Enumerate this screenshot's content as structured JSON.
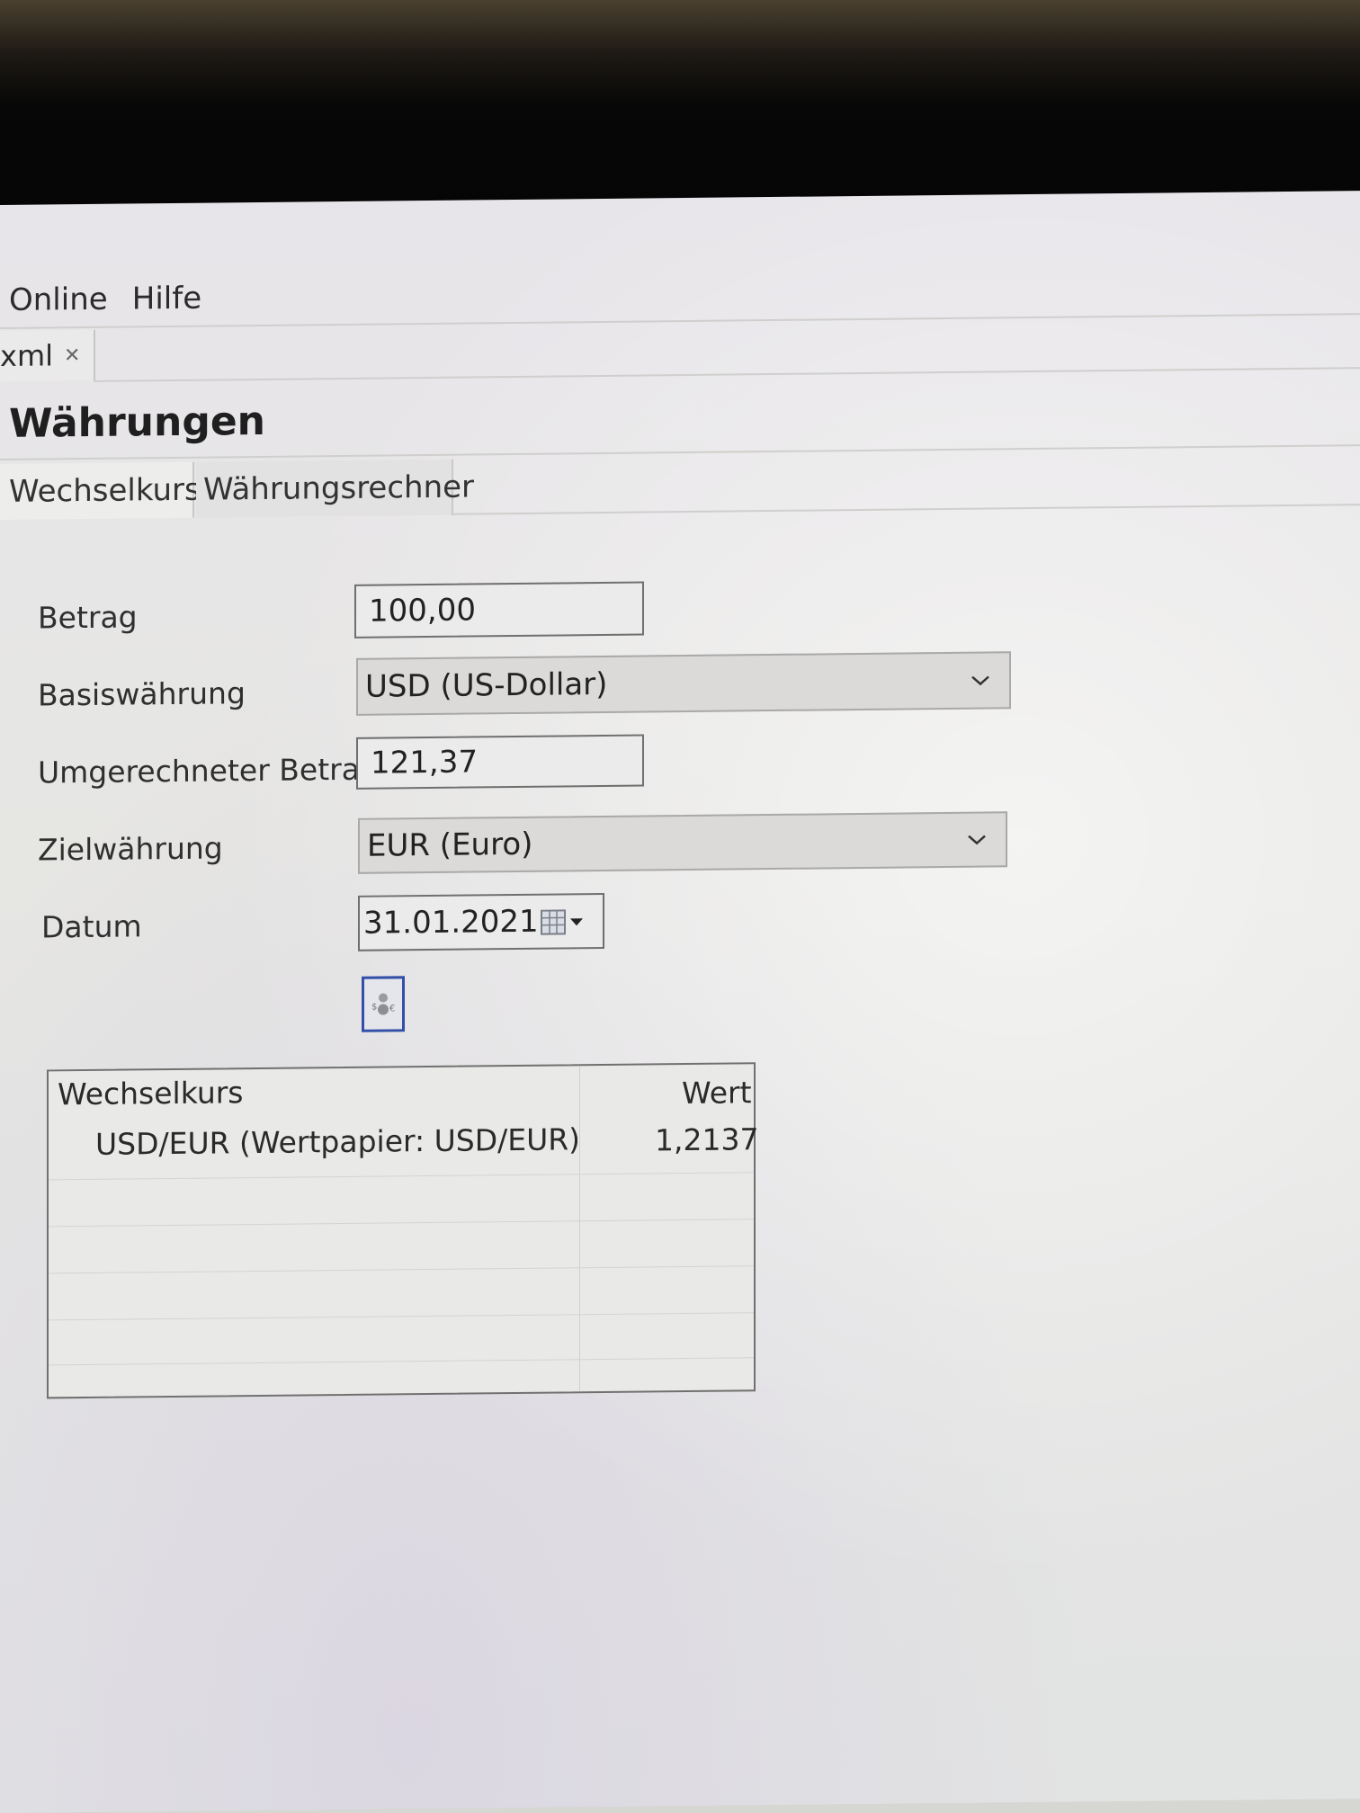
{
  "menu": {
    "items": [
      "Online",
      "Hilfe"
    ]
  },
  "editor_tab": {
    "label": "xml",
    "close_icon": "close-icon"
  },
  "page": {
    "title": "Währungen"
  },
  "subtabs": [
    {
      "label": "Wechselkurse"
    },
    {
      "label": "Währungsrechner"
    }
  ],
  "form": {
    "amount": {
      "label": "Betrag",
      "value": "100,00"
    },
    "base_currency": {
      "label": "Basiswährung",
      "value": "USD (US-Dollar)"
    },
    "converted_amount": {
      "label": "Umgerechneter Betrag",
      "value": "121,37"
    },
    "target_currency": {
      "label": "Zielwährung",
      "value": "EUR (Euro)"
    },
    "date": {
      "label": "Datum",
      "value": "31.01.2021"
    },
    "calculate_icon": "calculator-icon"
  },
  "rates_table": {
    "headers": [
      "Wechselkurs",
      "Wert"
    ],
    "rows": [
      {
        "rate": "USD/EUR (Wertpapier: USD/EUR) We",
        "value": "1,2137"
      }
    ]
  },
  "colors": {
    "button_focus": "#3350a8",
    "background": "#e6e6e3"
  }
}
